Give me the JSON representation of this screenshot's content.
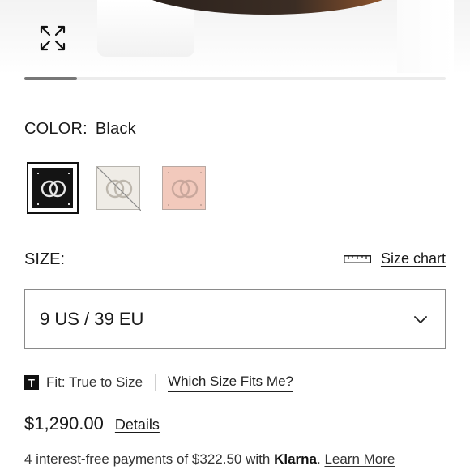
{
  "gallery": {
    "progress_fraction": 0.125
  },
  "color": {
    "label": "COLOR:",
    "value": "Black",
    "swatches": [
      {
        "name": "black",
        "hex": "#141414",
        "selected": true
      },
      {
        "name": "white",
        "hex": "#efece6",
        "selected": false,
        "unavailable": true
      },
      {
        "name": "pink",
        "hex": "#f2c9bc",
        "selected": false
      }
    ]
  },
  "size": {
    "label": "SIZE:",
    "chart_link": "Size chart",
    "selected": "9 US / 39 EU"
  },
  "fit": {
    "badge": "T",
    "text": "Fit: True to Size",
    "which_link": "Which Size Fits Me?"
  },
  "price": {
    "amount": "$1,290.00",
    "details_link": "Details"
  },
  "klarna": {
    "prefix": "4 interest-free payments of $322.50 with ",
    "brand": "Klarna",
    "separator": ". ",
    "learn_more": "Learn More"
  },
  "icons": {
    "expand": "expand-arrows-icon",
    "ruler": "ruler-icon",
    "chevron": "chevron-down-icon"
  }
}
